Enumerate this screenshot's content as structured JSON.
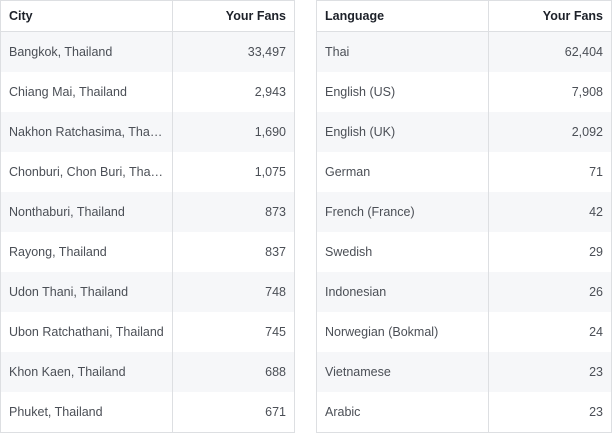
{
  "city_table": {
    "headers": {
      "name": "City",
      "fans": "Your Fans"
    },
    "rows": [
      {
        "name": "Bangkok, Thailand",
        "fans": "33,497"
      },
      {
        "name": "Chiang Mai, Thailand",
        "fans": "2,943"
      },
      {
        "name": "Nakhon Ratchasima, Thail…",
        "fans": "1,690"
      },
      {
        "name": "Chonburi, Chon Buri, Thail…",
        "fans": "1,075"
      },
      {
        "name": "Nonthaburi, Thailand",
        "fans": "873"
      },
      {
        "name": "Rayong, Thailand",
        "fans": "837"
      },
      {
        "name": "Udon Thani, Thailand",
        "fans": "748"
      },
      {
        "name": "Ubon Ratchathani, Thailand",
        "fans": "745"
      },
      {
        "name": "Khon Kaen, Thailand",
        "fans": "688"
      },
      {
        "name": "Phuket, Thailand",
        "fans": "671"
      }
    ]
  },
  "language_table": {
    "headers": {
      "name": "Language",
      "fans": "Your Fans"
    },
    "rows": [
      {
        "name": "Thai",
        "fans": "62,404"
      },
      {
        "name": "English (US)",
        "fans": "7,908"
      },
      {
        "name": "English (UK)",
        "fans": "2,092"
      },
      {
        "name": "German",
        "fans": "71"
      },
      {
        "name": "French (France)",
        "fans": "42"
      },
      {
        "name": "Swedish",
        "fans": "29"
      },
      {
        "name": "Indonesian",
        "fans": "26"
      },
      {
        "name": "Norwegian (Bokmal)",
        "fans": "24"
      },
      {
        "name": "Vietnamese",
        "fans": "23"
      },
      {
        "name": "Arabic",
        "fans": "23"
      }
    ]
  }
}
